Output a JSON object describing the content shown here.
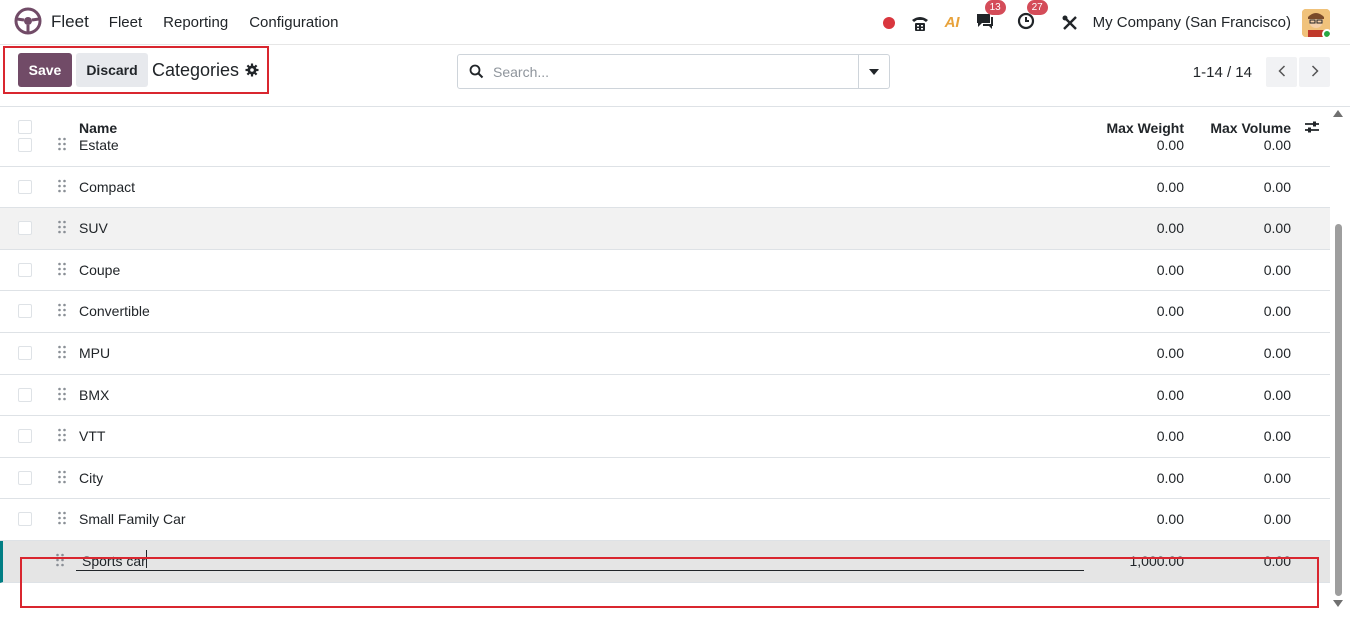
{
  "navbar": {
    "app_name": "Fleet",
    "menu": [
      "Fleet",
      "Reporting",
      "Configuration"
    ],
    "icons": [
      "recording-dot-icon",
      "phone-icon",
      "ai-icon",
      "messages-icon",
      "activity-clock-icon",
      "tools-icon"
    ],
    "messages_badge": "13",
    "activities_badge": "27",
    "ai_label": "AI",
    "company": "My Company (San Francisco)"
  },
  "control_panel": {
    "save_label": "Save",
    "discard_label": "Discard",
    "title": "Categories",
    "search_placeholder": "Search...",
    "pager": "1-14 / 14"
  },
  "list": {
    "columns": {
      "name": "Name",
      "max_weight": "Max Weight",
      "max_volume": "Max Volume"
    },
    "rows": [
      {
        "name": "Estate",
        "max_weight": "0.00",
        "max_volume": "0.00"
      },
      {
        "name": "Compact",
        "max_weight": "0.00",
        "max_volume": "0.00"
      },
      {
        "name": "SUV",
        "max_weight": "0.00",
        "max_volume": "0.00"
      },
      {
        "name": "Coupe",
        "max_weight": "0.00",
        "max_volume": "0.00"
      },
      {
        "name": "Convertible",
        "max_weight": "0.00",
        "max_volume": "0.00"
      },
      {
        "name": "MPU",
        "max_weight": "0.00",
        "max_volume": "0.00"
      },
      {
        "name": "BMX",
        "max_weight": "0.00",
        "max_volume": "0.00"
      },
      {
        "name": "VTT",
        "max_weight": "0.00",
        "max_volume": "0.00"
      },
      {
        "name": "City",
        "max_weight": "0.00",
        "max_volume": "0.00"
      },
      {
        "name": "Small Family Car",
        "max_weight": "0.00",
        "max_volume": "0.00"
      }
    ],
    "editing_row": {
      "name": "Sports car",
      "max_weight": "1,000.00",
      "max_volume": "0.00"
    }
  },
  "colors": {
    "primary": "#714b67",
    "highlight": "#d9262f",
    "badge": "#d44c59",
    "edit_accent": "#017e84"
  }
}
